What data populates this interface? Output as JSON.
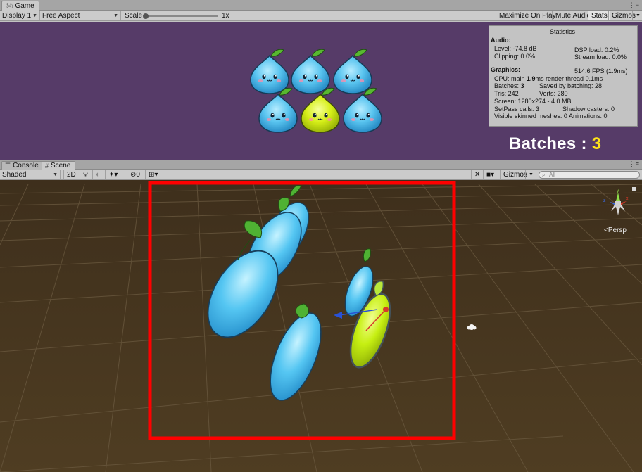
{
  "game_window": {
    "tab_title": "Game",
    "toolbar": {
      "display": "Display 1",
      "aspect": "Free Aspect",
      "scale_label": "Scale",
      "scale_value": "1x",
      "maximize": "Maximize On Play",
      "mute": "Mute Audio",
      "stats": "Stats",
      "gizmos": "Gizmos"
    }
  },
  "statistics": {
    "title": "Statistics",
    "audio_header": "Audio:",
    "level": "Level: -74.8 dB",
    "clipping": "Clipping: 0.0%",
    "dsp_load": "DSP load: 0.2%",
    "stream_load": "Stream load: 0.0%",
    "graphics_header": "Graphics:",
    "fps": "514.6 FPS (1.9ms)",
    "cpu_prefix": "CPU: main ",
    "cpu_main": "1.9",
    "cpu_suffix": "ms  render thread 0.1ms",
    "batches_prefix": "Batches: ",
    "batches_value": "3",
    "saved_by_batching": "Saved by batching: 28",
    "tris": "Tris: 242",
    "verts": "Verts: 280",
    "screen": "Screen: 1280x274 - 4.0 MB",
    "setpass": "SetPass calls: 3",
    "shadow_casters": "Shadow casters: 0",
    "skinned": "Visible skinned meshes: 0",
    "animations": "Animations: 0"
  },
  "batches_overlay": {
    "label": "Batches : ",
    "value": "3"
  },
  "scene_window": {
    "tabs": [
      {
        "label": "Console",
        "icon": "console-icon"
      },
      {
        "label": "Scene",
        "icon": "scene-icon"
      }
    ],
    "toolbar": {
      "shading": "Shaded",
      "mode_2d": "2D",
      "hidden_count": "0",
      "gizmos": "Gizmos",
      "search_placeholder": "All"
    },
    "persp_label": "<Persp"
  },
  "colors": {
    "game_background": "#563b68",
    "scene_background": "#463620",
    "selection_frame": "#ff0000",
    "overlay_value": "#ffe419",
    "slime_blue": "#5fc8ee",
    "slime_yellow": "#d7f218",
    "leaf_green": "#4fb233"
  }
}
